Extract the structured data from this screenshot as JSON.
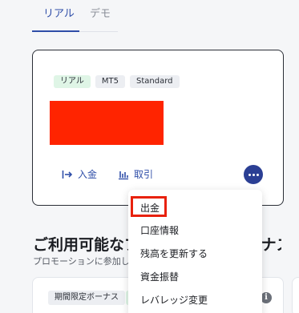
{
  "tabs": [
    {
      "label": "リアル",
      "active": true
    },
    {
      "label": "デモ",
      "active": false
    }
  ],
  "account": {
    "badges": [
      "リアル",
      "MT5",
      "Standard"
    ],
    "actions": {
      "deposit_label": "入金",
      "trade_label": "取引"
    }
  },
  "menu": {
    "items": [
      "出金",
      "口座情報",
      "残高を更新する",
      "資金振替",
      "レバレッジ変更"
    ]
  },
  "section": {
    "title": "ご利用可能なプロモーションボーナス",
    "subtitle": "プロモーションに参加して"
  },
  "promo": {
    "badge": "期間限定ボーナス"
  },
  "colors": {
    "accent": "#2f4ea8",
    "more_button": "#2b3f94",
    "highlight": "#e8210c",
    "redaction": "#ff2400"
  }
}
